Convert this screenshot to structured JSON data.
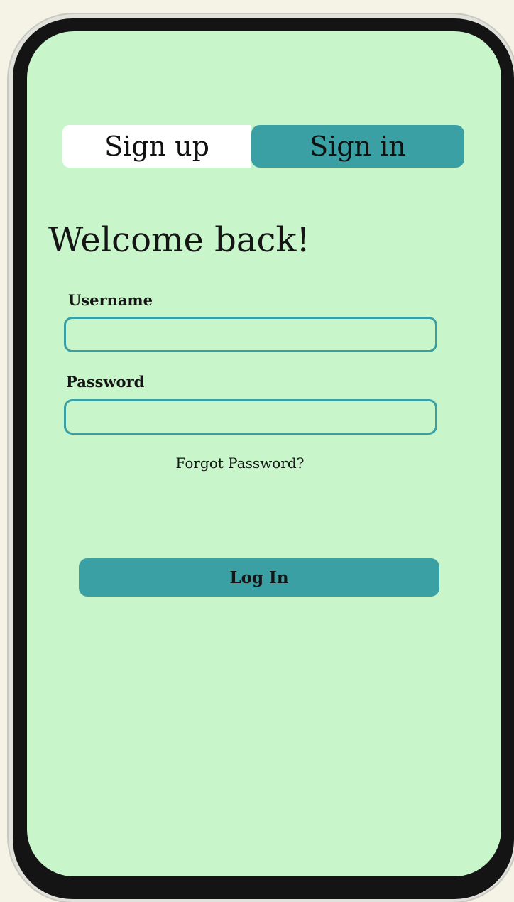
{
  "tabs": {
    "signup_label": "Sign up",
    "signin_label": "Sign in",
    "active": "signin"
  },
  "heading": "Welcome back!",
  "form": {
    "username_label": "Username",
    "username_value": "",
    "username_placeholder": "",
    "password_label": "Password",
    "password_value": "",
    "password_placeholder": "",
    "forgot_label": "Forgot Password?",
    "login_label": "Log In"
  },
  "colors": {
    "screen_background": "#c8f5ca",
    "accent": "#3aa0a4",
    "page_background": "#f4f3e6",
    "bezel": "#141414"
  }
}
